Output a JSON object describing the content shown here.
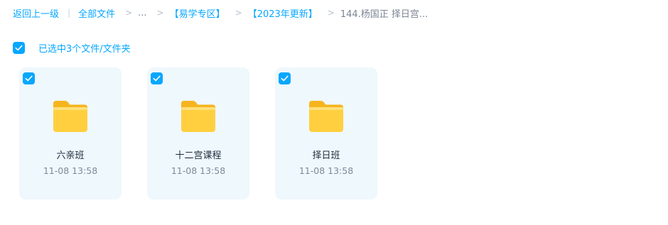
{
  "breadcrumb": {
    "back": "返回上一级",
    "all_files": "全部文件",
    "ellipsis": "...",
    "crumb1": "【易学专区】",
    "crumb2": "【2023年更新】",
    "current": "144.杨国正 择日宫..."
  },
  "selection": {
    "label": "已选中3个文件/文件夹"
  },
  "colors": {
    "accent": "#06a7ff",
    "card_bg": "#eff8fd",
    "folder_yellow": "#ffcf3f"
  },
  "items": [
    {
      "name": "六亲班",
      "time": "11-08 13:58",
      "icon": "folder-icon",
      "selected": true
    },
    {
      "name": "十二宫课程",
      "time": "11-08 13:58",
      "icon": "folder-icon",
      "selected": true
    },
    {
      "name": "择日班",
      "time": "11-08 13:58",
      "icon": "folder-icon",
      "selected": true
    }
  ]
}
